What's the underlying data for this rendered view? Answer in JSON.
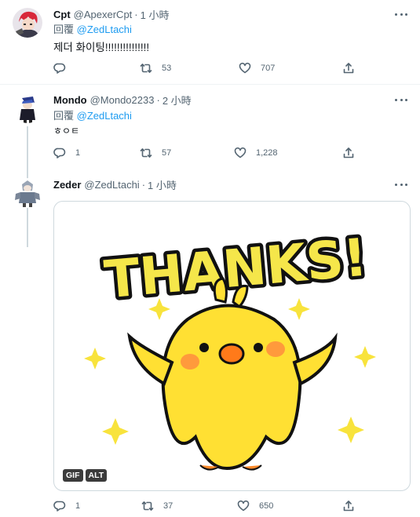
{
  "tweets": [
    {
      "name": "Cpt",
      "handle": "@ApexerCpt",
      "separator": "·",
      "time": "1 小時",
      "reply_prefix": "回覆",
      "reply_to": "@ZedLtachi",
      "text": "제더 화이팅!!!!!!!!!!!!!!!",
      "replies": "",
      "retweets": "53",
      "likes": "707"
    },
    {
      "name": "Mondo",
      "handle": "@Mondo2233",
      "separator": "·",
      "time": "2 小時",
      "reply_prefix": "回覆",
      "reply_to": "@ZedLtachi",
      "text": "ㅎㅇㅌ",
      "replies": "1",
      "retweets": "57",
      "likes": "1,228"
    },
    {
      "name": "Zeder",
      "handle": "@ZedLtachi",
      "separator": "·",
      "time": "1 小時",
      "replies": "1",
      "retweets": "37",
      "likes": "650",
      "media": {
        "gif_badge": "GIF",
        "alt_badge": "ALT",
        "gif_text": "THANKS!"
      }
    }
  ],
  "colors": {
    "accent": "#1d9bf0",
    "secondary_text": "#536471",
    "chick_yellow": "#ffe033",
    "thanks_yellow": "#f5e64a"
  },
  "icons": [
    "more-icon",
    "reply-icon",
    "retweet-icon",
    "like-icon",
    "share-icon"
  ]
}
